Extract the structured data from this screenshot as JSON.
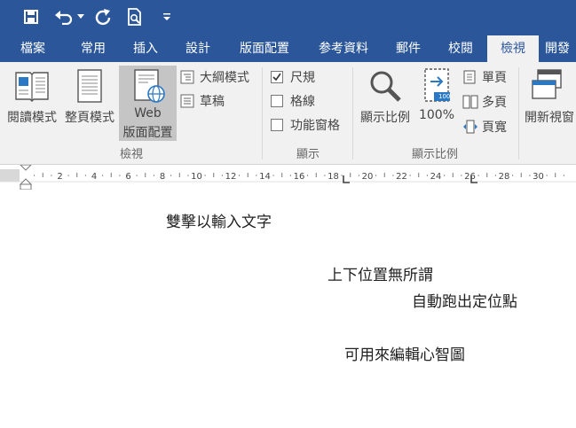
{
  "qat": {
    "icons": [
      "save-icon",
      "undo-icon",
      "undo-dropdown-icon",
      "redo-icon",
      "print-preview-icon",
      "customize-qat-icon"
    ]
  },
  "tabs": [
    {
      "label": "檔案"
    },
    {
      "label": "常用"
    },
    {
      "label": "插入"
    },
    {
      "label": "設計"
    },
    {
      "label": "版面配置"
    },
    {
      "label": "参考資料"
    },
    {
      "label": "郵件"
    },
    {
      "label": "校閱"
    },
    {
      "label": "檢視"
    },
    {
      "label": "開發"
    }
  ],
  "active_tab": "檢視",
  "ribbon": {
    "views": {
      "read_mode": "閱讀模式",
      "print_layout": "整頁模式",
      "web_layout_1": "Web",
      "web_layout_2": "版面配置",
      "outline": "大綱模式",
      "draft": "草稿",
      "group_label": "檢視"
    },
    "show": {
      "ruler": {
        "label": "尺規",
        "checked": true
      },
      "gridlines": {
        "label": "格線",
        "checked": false
      },
      "nav_pane": {
        "label": "功能窗格",
        "checked": false
      },
      "group_label": "顯示"
    },
    "zoom": {
      "zoom_label": "顯示比例",
      "hundred_label": "100%",
      "one_page": "單頁",
      "multi_page": "多頁",
      "page_width": "頁寬",
      "group_label": "顯示比例",
      "badge": "100"
    },
    "window": {
      "new_window": "開新視窗"
    }
  },
  "ruler": {
    "ticks": [
      "2",
      "4",
      "6",
      "8",
      "10",
      "12",
      "14",
      "16",
      "18",
      "20",
      "22",
      "24",
      "26",
      "28",
      "30"
    ]
  },
  "document": {
    "lines": [
      "雙擊以輸入文字",
      "上下位置無所謂",
      "自動跑出定位點",
      "可用來編輯心智圖"
    ]
  },
  "colors": {
    "accent": "#2b579a",
    "ribbon_bg": "#f1f1f1",
    "selected_btn": "#c5c5c5"
  }
}
